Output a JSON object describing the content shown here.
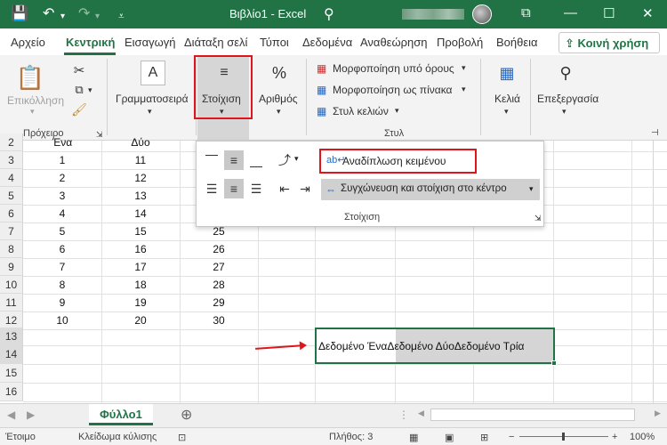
{
  "titlebar": {
    "title": "Βιβλίο1 - Excel",
    "colors": {
      "bg": "#217346"
    }
  },
  "tabs": [
    {
      "label": "Αρχείο"
    },
    {
      "label": "Κεντρική"
    },
    {
      "label": "Εισαγωγή"
    },
    {
      "label": "Διάταξη σελί"
    },
    {
      "label": "Τύποι"
    },
    {
      "label": "Δεδομένα"
    },
    {
      "label": "Αναθεώρηση"
    },
    {
      "label": "Προβολή"
    },
    {
      "label": "Βοήθεια"
    }
  ],
  "share_label": "Κοινή χρήση",
  "ribbon": {
    "paste_label": "Επικόλληση",
    "clipboard_group": "Πρόχειρο",
    "font_label": "Γραμματοσειρά",
    "alignment_label": "Στοίχιση",
    "number_label": "Αριθμός",
    "cond_format": "Μορφοποίηση υπό όρους",
    "format_table": "Μορφοποίηση ως πίνακα",
    "cell_styles": "Στυλ κελιών",
    "styles_group": "Στυλ",
    "cells_label": "Κελιά",
    "editing_label": "Επεξεργασία"
  },
  "alignment_menu": {
    "wrap_text": "Αναδίπλωση κειμένου",
    "merge_center": "Συγχώνευση και στοίχιση στο κέντρο",
    "group_label": "Στοίχιση"
  },
  "grid": {
    "header_row": [
      "2",
      "Ένα",
      "Δύο"
    ],
    "rows": [
      {
        "n": "3",
        "a": "1",
        "b": "11",
        "c": ""
      },
      {
        "n": "4",
        "a": "2",
        "b": "12",
        "c": ""
      },
      {
        "n": "5",
        "a": "3",
        "b": "13",
        "c": ""
      },
      {
        "n": "6",
        "a": "4",
        "b": "14",
        "c": ""
      },
      {
        "n": "7",
        "a": "5",
        "b": "15",
        "c": "25"
      },
      {
        "n": "8",
        "a": "6",
        "b": "16",
        "c": "26"
      },
      {
        "n": "9",
        "a": "7",
        "b": "17",
        "c": "27"
      },
      {
        "n": "10",
        "a": "8",
        "b": "18",
        "c": "28"
      },
      {
        "n": "11",
        "a": "9",
        "b": "19",
        "c": "29"
      },
      {
        "n": "12",
        "a": "10",
        "b": "20",
        "c": "30"
      }
    ],
    "empty_rows": [
      "13",
      "14",
      "15",
      "16"
    ],
    "merged_text": "Δεδομένο ΈναΔεδομένο ΔύοΔεδομένο Τρία"
  },
  "sheet_tab": "Φύλλο1",
  "status": {
    "ready": "Έτοιμο",
    "scroll_lock": "Κλείδωμα κύλισης",
    "count": "Πλήθος: 3",
    "zoom": "100%"
  }
}
